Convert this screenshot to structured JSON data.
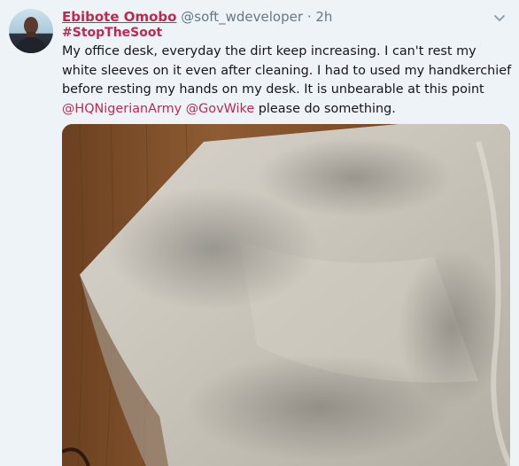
{
  "tweet": {
    "author_name": "Ebibote Omobo",
    "handle": "@soft_wdeveloper",
    "separator": "·",
    "time": "2h",
    "hashtag": "#StopTheSoot",
    "body_text": "My office desk, everyday the dirt keep increasing. I can't rest my white sleeves on it even after cleaning. I had to used my handkerchief before resting my hands on my desk. It is unbearable at this point ",
    "mention_1": "@HQNigerianArmy",
    "mention_2": "@GovWike",
    "body_tail": " please do something.",
    "space": " "
  },
  "icons": {
    "caret": "chevron-down-icon",
    "avatar": "avatar"
  },
  "colors": {
    "brand": "#c0284f",
    "muted": "#657786",
    "text": "#14171a",
    "background": "#eef3f7"
  }
}
